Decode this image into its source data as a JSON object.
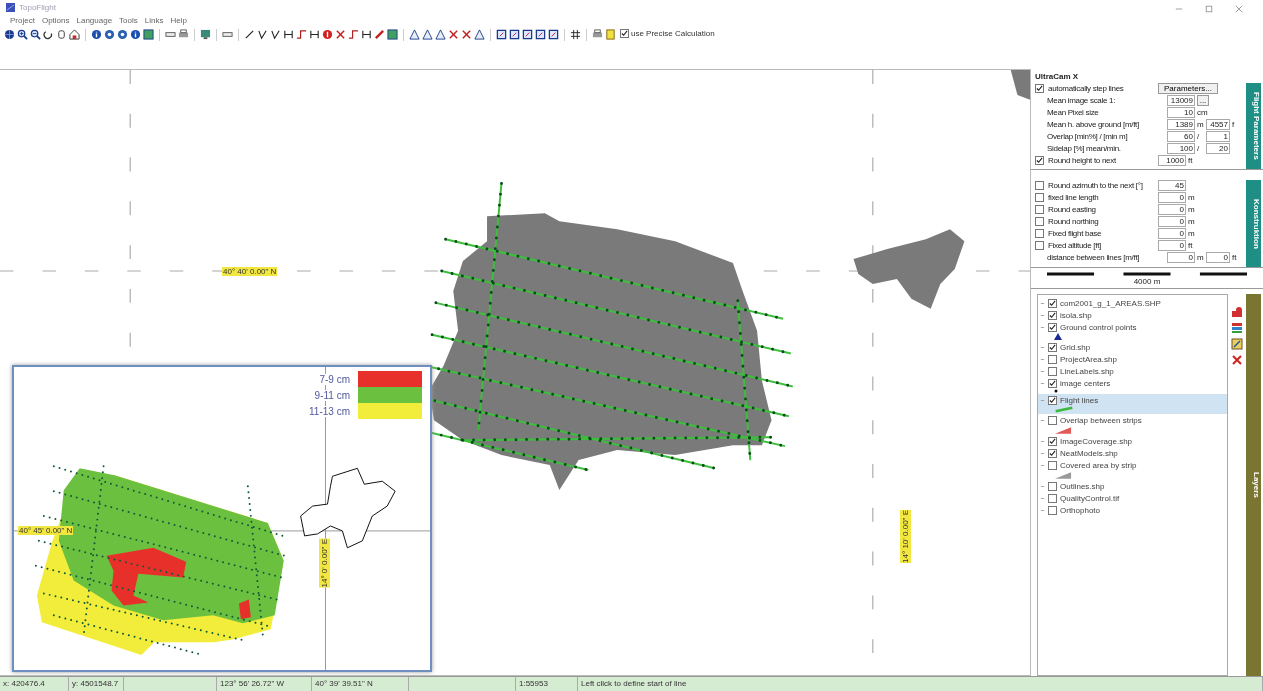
{
  "window": {
    "title": "TopoFlight"
  },
  "menu": [
    "Project",
    "Options",
    "Language",
    "Tools",
    "Links",
    "Help"
  ],
  "toolbar": {
    "precise_calculation": {
      "label": "use Precise Calculation",
      "checked": true
    }
  },
  "map": {
    "labels": [
      {
        "text": "40° 40' 0.00\" N",
        "kind": "horizontal"
      },
      {
        "text": "14° 10' 0.00\" E",
        "kind": "vertical"
      }
    ],
    "inset": {
      "labels": [
        {
          "text": "40° 45' 0.00\" N",
          "kind": "horizontal"
        },
        {
          "text": "14° 0' 0.00\" E",
          "kind": "vertical"
        }
      ],
      "legend": [
        {
          "label": "7-9 cm",
          "color": "#e8302a"
        },
        {
          "label": "9-11 cm",
          "color": "#6cc040"
        },
        {
          "label": "11-13 cm",
          "color": "#f2ec3a"
        }
      ]
    }
  },
  "camera": {
    "title": "UltraCam X"
  },
  "flight_parameters": {
    "tab": "Flight Parameters",
    "rows": [
      {
        "label": "automatically step lines",
        "checked": true,
        "button": "Parameters..."
      },
      {
        "label": "Mean image scale 1:",
        "fields": [
          {
            "value": "13009",
            "button": "..."
          }
        ]
      },
      {
        "label": "Mean Pixel size",
        "fields": [
          {
            "value": "10",
            "unit": "cm"
          }
        ]
      },
      {
        "label": "Mean h. above ground [m/ft]",
        "fields": [
          {
            "value": "1389",
            "unit": "m"
          },
          {
            "value": "4557",
            "unit": "f"
          }
        ]
      },
      {
        "label": "Overlap [min%] / [min m]",
        "fields": [
          {
            "value": "60",
            "unit": "/"
          },
          {
            "value": "1"
          }
        ]
      },
      {
        "label": "Sidelap [%] mean/min.",
        "fields": [
          {
            "value": "100",
            "unit": "/"
          },
          {
            "value": "20"
          }
        ]
      },
      {
        "label": "Round height to next",
        "checked": true,
        "fields": [
          {
            "value": "1000",
            "unit": "ft"
          }
        ]
      }
    ]
  },
  "construction": {
    "tab": "Konstruktion",
    "rows": [
      {
        "label": "Round azimuth to the next [°]",
        "checked": false,
        "fields": [
          {
            "value": "45"
          }
        ]
      },
      {
        "label": "fixed line length",
        "checked": false,
        "fields": [
          {
            "value": "0",
            "unit": "m"
          }
        ]
      },
      {
        "label": "Round easting",
        "checked": false,
        "fields": [
          {
            "value": "0",
            "unit": "m"
          }
        ]
      },
      {
        "label": "Round northing",
        "checked": false,
        "fields": [
          {
            "value": "0",
            "unit": "m"
          }
        ]
      },
      {
        "label": "Fixed flight base",
        "checked": false,
        "fields": [
          {
            "value": "0",
            "unit": "m"
          }
        ]
      },
      {
        "label": "Fixed altitude [ft]",
        "checked": false,
        "fields": [
          {
            "value": "0",
            "unit": "ft"
          }
        ]
      },
      {
        "label": "distance between lines [m/ft]",
        "fields": [
          {
            "value": "0",
            "unit": "m"
          },
          {
            "value": "0",
            "unit": "ft"
          }
        ]
      }
    ]
  },
  "scale_bar": "4000 m",
  "layers": {
    "tab": "Layers",
    "items": [
      {
        "name": "com2001_g_1_AREAS.SHP",
        "checked": true,
        "selected": false
      },
      {
        "name": "isola.shp",
        "checked": true,
        "selected": false
      },
      {
        "name": "Ground control points",
        "checked": true,
        "selected": false,
        "symbol": {
          "kind": "triangle",
          "color": "#1a2a9a"
        }
      },
      {
        "name": "Grid.shp",
        "checked": true,
        "selected": false
      },
      {
        "name": "ProjectArea.shp",
        "checked": false,
        "selected": false
      },
      {
        "name": "LineLabels.shp",
        "checked": false,
        "selected": false
      },
      {
        "name": "image centers",
        "checked": true,
        "selected": false,
        "symbol": {
          "kind": "dot",
          "color": "#111111"
        }
      },
      {
        "name": "Flight lines",
        "checked": true,
        "selected": true,
        "symbol": {
          "kind": "line",
          "color": "#3cb83c"
        }
      },
      {
        "name": "Overlap between strips",
        "checked": false,
        "selected": false,
        "symbol": {
          "kind": "wedge",
          "color": "#e05a5a"
        }
      },
      {
        "name": "ImageCoverage.shp",
        "checked": true,
        "selected": false
      },
      {
        "name": "NeatModels.shp",
        "checked": true,
        "selected": false
      },
      {
        "name": "Covered area by strip",
        "checked": false,
        "selected": false,
        "symbol": {
          "kind": "wedge",
          "color": "#9a9a9a"
        }
      },
      {
        "name": "Outlines.shp",
        "checked": false,
        "selected": false
      },
      {
        "name": "QualityControl.tif",
        "checked": false,
        "selected": false
      },
      {
        "name": "Orthophoto",
        "checked": false,
        "selected": false
      }
    ]
  },
  "status_bar": [
    "x: 420476.4",
    "y: 4501548.7",
    "123° 56' 26.72\" W",
    "40° 39' 39.51\" N",
    "1:55953",
    "Left click to define start of line"
  ]
}
